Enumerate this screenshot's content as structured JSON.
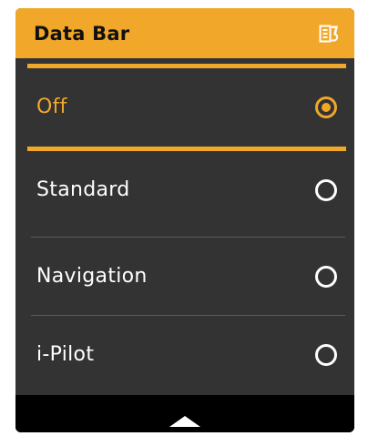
{
  "theme": {
    "accent": "#f0a72a",
    "panel_bg": "#333333",
    "frame_bg": "#000000",
    "text": "#ffffff"
  },
  "header": {
    "title": "Data Bar",
    "icon": "exit-menu-icon"
  },
  "options": [
    {
      "label": "Off",
      "selected": true
    },
    {
      "label": "Standard",
      "selected": false
    },
    {
      "label": "Navigation",
      "selected": false
    },
    {
      "label": "i-Pilot",
      "selected": false
    }
  ],
  "footer": {
    "icon": "chevron-up-icon"
  }
}
